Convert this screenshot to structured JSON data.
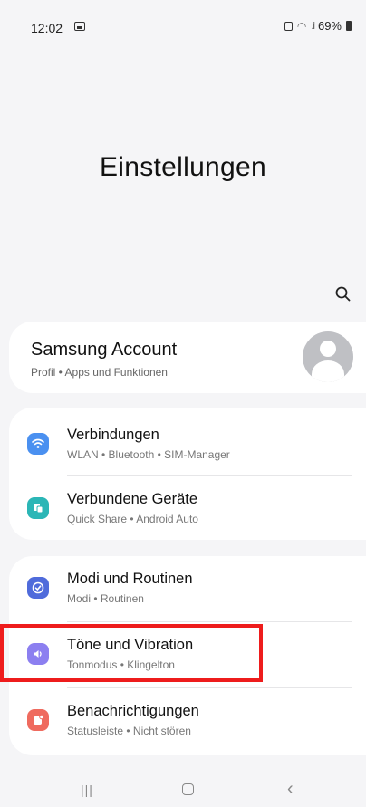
{
  "status": {
    "time": "12:02",
    "battery": "69%"
  },
  "header": {
    "title": "Einstellungen"
  },
  "account": {
    "title": "Samsung Account",
    "subtitle": "Profil • Apps und Funktionen"
  },
  "groups": [
    {
      "items": [
        {
          "title": "Verbindungen",
          "subtitle": "WLAN • Bluetooth • SIM-Manager",
          "icon": "wifi-icon",
          "color": "#4a90f0"
        },
        {
          "title": "Verbundene Geräte",
          "subtitle": "Quick Share • Android Auto",
          "icon": "devices-icon",
          "color": "#2bb6b6"
        }
      ]
    },
    {
      "items": [
        {
          "title": "Modi und Routinen",
          "subtitle": "Modi • Routinen",
          "icon": "check-circle-icon",
          "color": "#4f6bdb"
        },
        {
          "title": "Töne und Vibration",
          "subtitle": "Tonmodus • Klingelton",
          "icon": "speaker-icon",
          "color": "#8c7ff0"
        },
        {
          "title": "Benachrichtigungen",
          "subtitle": "Statusleiste • Nicht stören",
          "icon": "notification-icon",
          "color": "#ef6b5f"
        }
      ]
    }
  ],
  "navbar": {
    "recents": "|||",
    "back": "‹"
  }
}
